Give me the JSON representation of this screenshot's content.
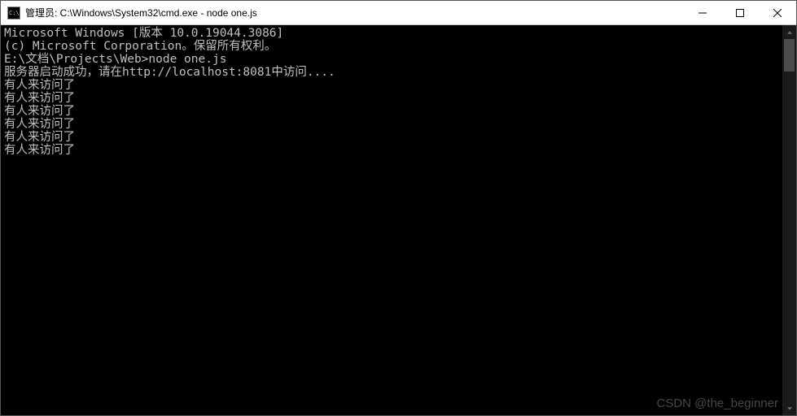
{
  "titlebar": {
    "title": "管理员: C:\\Windows\\System32\\cmd.exe - node  one.js"
  },
  "console": {
    "lines": [
      "Microsoft Windows [版本 10.0.19044.3086]",
      "(c) Microsoft Corporation。保留所有权利。",
      "",
      "E:\\文档\\Projects\\Web>node one.js",
      "服务器启动成功，请在http://localhost:8081中访问....",
      "有人来访问了",
      "有人来访问了",
      "有人来访问了",
      "有人来访问了",
      "有人来访问了",
      "有人来访问了"
    ]
  },
  "watermark": "CSDN @the_beginner"
}
